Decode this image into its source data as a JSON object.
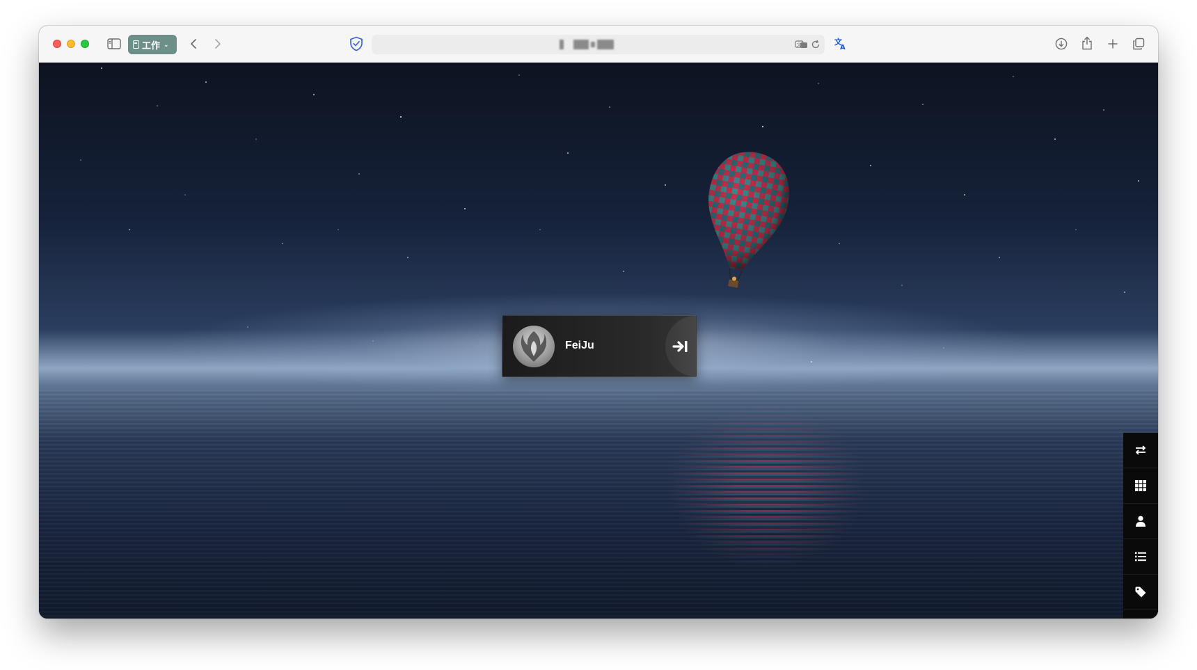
{
  "browser": {
    "tab_group_label": "工作",
    "url_text": ""
  },
  "login": {
    "username": "FeiJu"
  },
  "dock": {
    "items": [
      "swap-icon",
      "grid-icon",
      "user-icon",
      "list-icon",
      "tag-icon",
      "settings-icon"
    ]
  },
  "colors": {
    "tab_group": "#6d8f89",
    "privacy_shield": "#3b63e6",
    "translate_icon": "#1a56d6",
    "sky_top": "#0d1320",
    "horizon": "#8fa6c3"
  }
}
